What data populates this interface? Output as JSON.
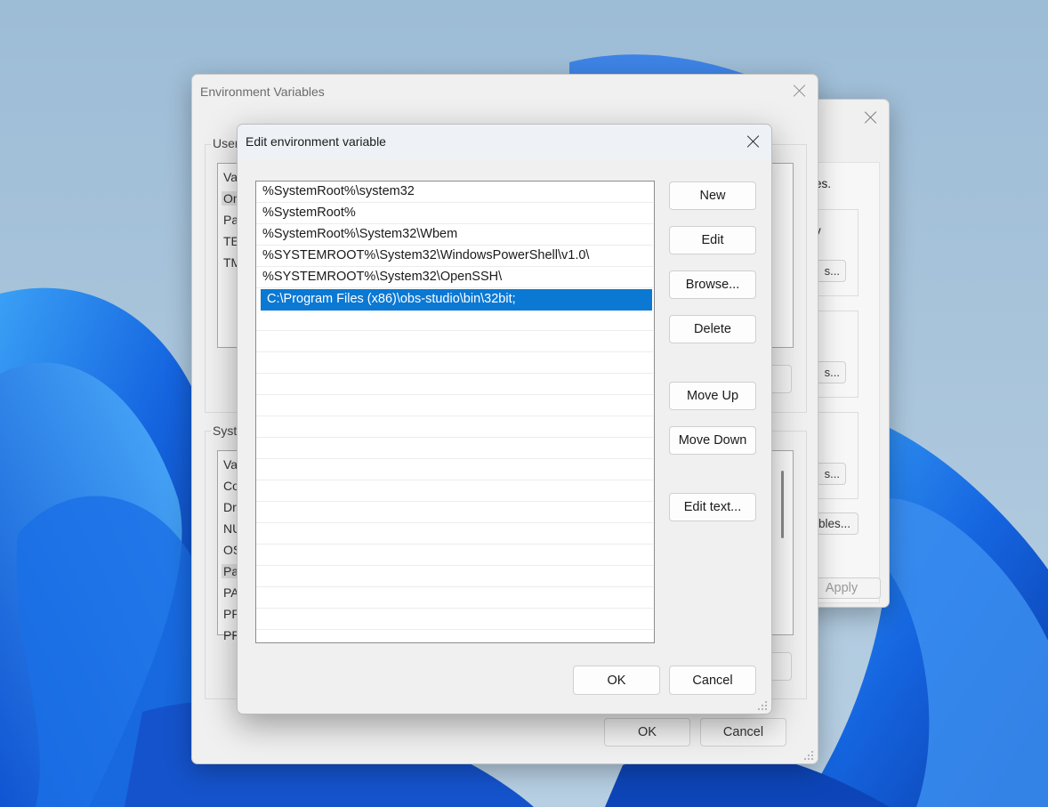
{
  "desktop": {
    "background_color": "#a9c4da",
    "accent_color": "#0b78d4"
  },
  "system_properties": {
    "visible_fragments": {
      "intro_text_tail": "es.",
      "group1_text_tail": "y",
      "group1_button_tail": "s...",
      "group2_button_tail": "s...",
      "group3_button_tail": "s...",
      "env_button_tail": "bles...",
      "apply_label": "Apply"
    }
  },
  "env_vars_dialog": {
    "title": "Environment Variables",
    "user_group_label": "User",
    "user_list_visible": [
      "Va",
      "On",
      "Pa",
      "TE",
      "TM"
    ],
    "system_group_label": "Syste",
    "system_list_visible": [
      "Va",
      "Co",
      "Dr",
      "NU",
      "OS",
      "Pa",
      "PA",
      "PR",
      "PR"
    ],
    "ok_label": "OK",
    "cancel_label": "Cancel"
  },
  "edit_dialog": {
    "title": "Edit environment variable",
    "entries": [
      "%SystemRoot%\\system32",
      "%SystemRoot%",
      "%SystemRoot%\\System32\\Wbem",
      "%SYSTEMROOT%\\System32\\WindowsPowerShell\\v1.0\\",
      "%SYSTEMROOT%\\System32\\OpenSSH\\",
      "C:\\Program Files (x86)\\obs-studio\\bin\\32bit;"
    ],
    "selected_index": 5,
    "buttons": {
      "new": "New",
      "edit": "Edit",
      "browse": "Browse...",
      "delete": "Delete",
      "move_up": "Move Up",
      "move_down": "Move Down",
      "edit_text": "Edit text..."
    },
    "ok_label": "OK",
    "cancel_label": "Cancel"
  }
}
